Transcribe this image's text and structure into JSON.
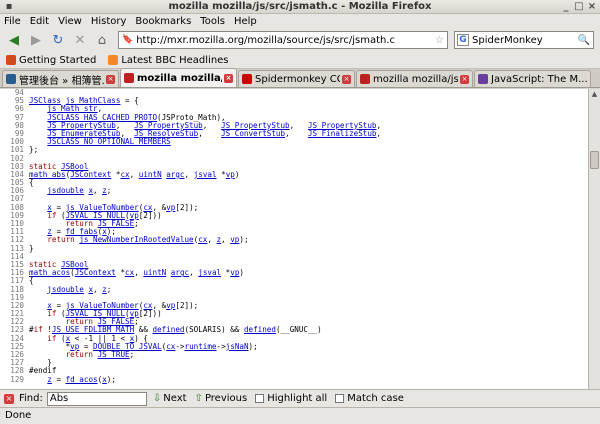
{
  "window": {
    "title": "mozilla mozilla/js/src/jsmath.c - Mozilla Firefox"
  },
  "menu": [
    "File",
    "Edit",
    "View",
    "History",
    "Bookmarks",
    "Tools",
    "Help"
  ],
  "navbar": {
    "url": "http://mxr.mozilla.org/mozilla/source/js/src/jsmath.c",
    "search_value": "SpiderMonkey"
  },
  "bookmarks": [
    {
      "label": "Getting Started",
      "icon": "firefox-icon",
      "color": "#d04a1e"
    },
    {
      "label": "Latest BBC Headlines",
      "icon": "rss-icon",
      "color": "#f08a24"
    }
  ],
  "tabs": [
    {
      "label": "管理後台 » 相簿管...",
      "icon": "wordpress-icon",
      "color": "#2a5d8f",
      "active": false
    },
    {
      "label": "mozilla mozilla/j...",
      "icon": "mozilla-icon",
      "color": "#b22",
      "active": true
    },
    {
      "label": "Spidermonkey CGI...",
      "icon": "maple-leaf-icon",
      "color": "#c00",
      "active": false
    },
    {
      "label": "mozilla mozilla/js/s...",
      "icon": "mozilla-icon",
      "color": "#b22",
      "active": false
    },
    {
      "label": "JavaScript: The M...",
      "icon": "page-icon",
      "color": "#6a3c9c",
      "active": false
    }
  ],
  "code_lines": [
    {
      "n": "94",
      "t": ""
    },
    {
      "n": "95",
      "t": "JSClass js_MathClass = {"
    },
    {
      "n": "96",
      "t": "    js_Math_str,"
    },
    {
      "n": "97",
      "t": "    JSCLASS_HAS_CACHED_PROTO(JSProto_Math),"
    },
    {
      "n": "98",
      "t": "    JS_PropertyStub,   JS_PropertyStub,   JS_PropertyStub,   JS_PropertyStub,"
    },
    {
      "n": "99",
      "t": "    JS_EnumerateStub,  JS_ResolveStub,    JS_ConvertStub,    JS_FinalizeStub,"
    },
    {
      "n": "100",
      "t": "    JSCLASS_NO_OPTIONAL_MEMBERS"
    },
    {
      "n": "101",
      "t": "};"
    },
    {
      "n": "102",
      "t": ""
    },
    {
      "n": "103",
      "t": "static JSBool"
    },
    {
      "n": "104",
      "t": "math_abs(JSContext *cx, uintN argc, jsval *vp)"
    },
    {
      "n": "105",
      "t": "{"
    },
    {
      "n": "106",
      "t": "    jsdouble x, z;"
    },
    {
      "n": "107",
      "t": ""
    },
    {
      "n": "108",
      "t": "    x = js_ValueToNumber(cx, &vp[2]);"
    },
    {
      "n": "109",
      "t": "    if (JSVAL_IS_NULL(vp[2]))"
    },
    {
      "n": "110",
      "t": "        return JS_FALSE;"
    },
    {
      "n": "111",
      "t": "    z = fd_fabs(x);"
    },
    {
      "n": "112",
      "t": "    return js_NewNumberInRootedValue(cx, z, vp);"
    },
    {
      "n": "113",
      "t": "}"
    },
    {
      "n": "114",
      "t": ""
    },
    {
      "n": "115",
      "t": "static JSBool"
    },
    {
      "n": "116",
      "t": "math_acos(JSContext *cx, uintN argc, jsval *vp)"
    },
    {
      "n": "117",
      "t": "{"
    },
    {
      "n": "118",
      "t": "    jsdouble x, z;"
    },
    {
      "n": "119",
      "t": ""
    },
    {
      "n": "120",
      "t": "    x = js_ValueToNumber(cx, &vp[2]);"
    },
    {
      "n": "121",
      "t": "    if (JSVAL_IS_NULL(vp[2]))"
    },
    {
      "n": "122",
      "t": "        return JS_FALSE;"
    },
    {
      "n": "123",
      "t": "#if !JS_USE_FDLIBM_MATH && defined(SOLARIS) && defined(__GNUC__)"
    },
    {
      "n": "124",
      "t": "    if (x < -1 || 1 < x) {"
    },
    {
      "n": "125",
      "t": "        *vp = DOUBLE_TO_JSVAL(cx->runtime->jsNaN);"
    },
    {
      "n": "126",
      "t": "        return JS_TRUE;"
    },
    {
      "n": "127",
      "t": "    }"
    },
    {
      "n": "128",
      "t": "#endif"
    },
    {
      "n": "129",
      "t": "    z = fd_acos(x);"
    }
  ],
  "findbar": {
    "label": "Find:",
    "value": "Abs",
    "next": "Next",
    "previous": "Previous",
    "highlight": "Highlight all",
    "match_case": "Match case"
  },
  "status": "Done"
}
